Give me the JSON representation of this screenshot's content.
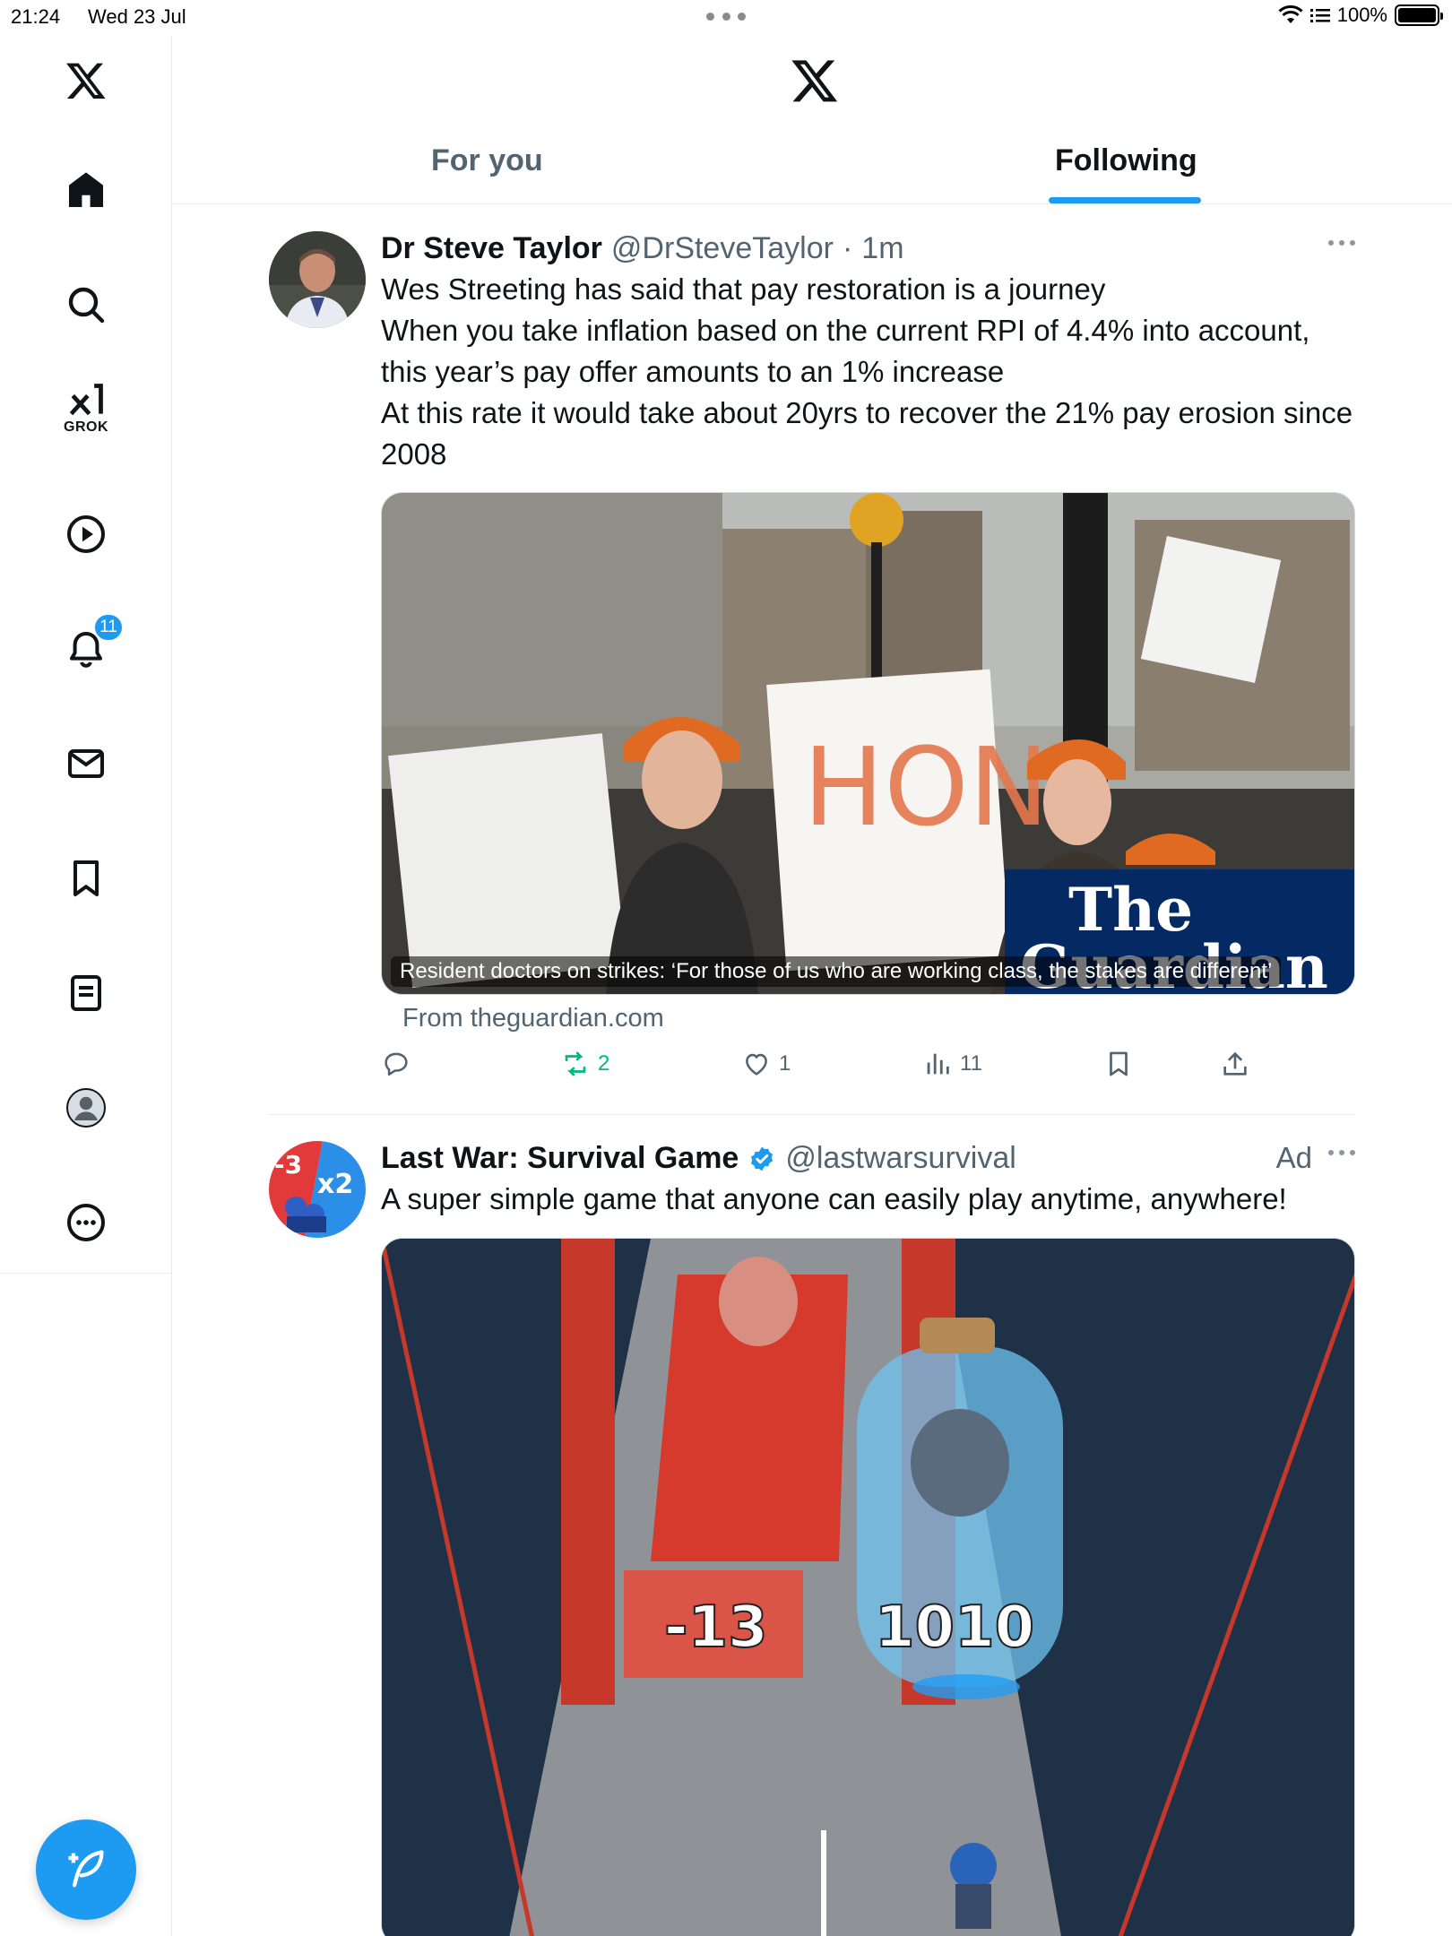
{
  "status_bar": {
    "time": "21:24",
    "date": "Wed 23 Jul",
    "battery": "100%"
  },
  "sidebar": {
    "items": [
      {
        "name": "x-logo-icon"
      },
      {
        "name": "home-icon"
      },
      {
        "name": "search-icon"
      },
      {
        "name": "grok-icon",
        "label": "GROK"
      },
      {
        "name": "video-icon"
      },
      {
        "name": "notifications-icon",
        "badge": "11"
      },
      {
        "name": "messages-icon"
      },
      {
        "name": "bookmarks-icon"
      },
      {
        "name": "lists-icon"
      },
      {
        "name": "profile-icon"
      },
      {
        "name": "more-icon"
      }
    ]
  },
  "header": {
    "tabs": [
      {
        "label": "For you",
        "active": false
      },
      {
        "label": "Following",
        "active": true
      }
    ],
    "accent": "#1d9bf0"
  },
  "tweets": [
    {
      "name": "Dr Steve Taylor",
      "handle": "@DrSteveTaylor",
      "time": "1m",
      "text_lines": [
        "Wes Streeting has said that pay restoration is a journey",
        "When you take inflation based on the current RPI of 4.4% into account, this year’s pay offer amounts to an 1% increase",
        "At this rate it would take about 20yrs to recover the 21% pay erosion since 2008"
      ],
      "media_caption": "Resident doctors on strikes: ‘For those of us who are working class, the stakes are different’",
      "media_brand": "The Guardian",
      "link_source": "From theguardian.com",
      "replies": "",
      "reposts": "2",
      "likes": "1",
      "views": "11"
    },
    {
      "name": "Last War: Survival Game",
      "handle": "@lastwarsurvival",
      "ad_label": "Ad",
      "verified": true,
      "text": "A super simple game that anyone can easily play anytime, anywhere!",
      "media_numbers": [
        "-13",
        "1010"
      ]
    }
  ]
}
